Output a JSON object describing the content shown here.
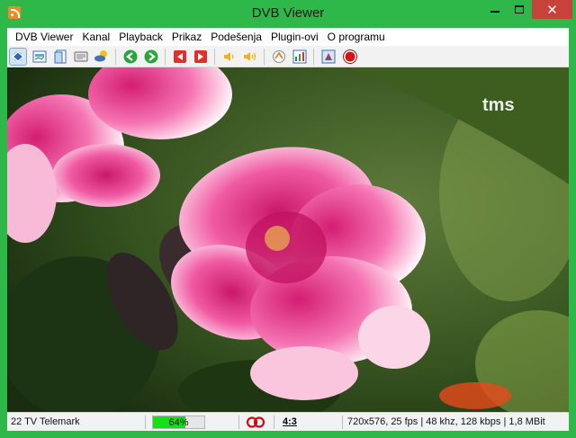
{
  "window": {
    "title": "DVB Viewer"
  },
  "menu": [
    "DVB Viewer",
    "Kanal",
    "Playback",
    "Prikaz",
    "Podešenja",
    "Plugin-ovi",
    "O programu"
  ],
  "toolbar": {
    "buttons": [
      {
        "icon": "osd-icon",
        "active": true
      },
      {
        "icon": "epg-icon"
      },
      {
        "icon": "channel-list-icon"
      },
      {
        "icon": "teletext-icon"
      },
      {
        "icon": "weather-icon"
      },
      {
        "icon": "back-arrow-icon"
      },
      {
        "icon": "forward-arrow-icon"
      },
      {
        "icon": "previous-channel-icon"
      },
      {
        "icon": "next-channel-icon"
      },
      {
        "icon": "volume-down-icon"
      },
      {
        "icon": "volume-up-icon"
      },
      {
        "icon": "snapshot-icon"
      },
      {
        "icon": "picture-settings-icon"
      },
      {
        "icon": "timer-icon"
      },
      {
        "icon": "record-icon"
      }
    ]
  },
  "video": {
    "logo": "tms"
  },
  "status": {
    "channel": "22 TV Telemark",
    "signal_percent": 64,
    "signal_label": "64%",
    "aspect": "4:3",
    "stream_info": "720x576, 25 fps | 48 khz, 128 kbps | 1,8 MBit"
  },
  "colors": {
    "frame": "#2fb84a",
    "close_button": "#c7423a",
    "signal_fill": "#14e014"
  }
}
